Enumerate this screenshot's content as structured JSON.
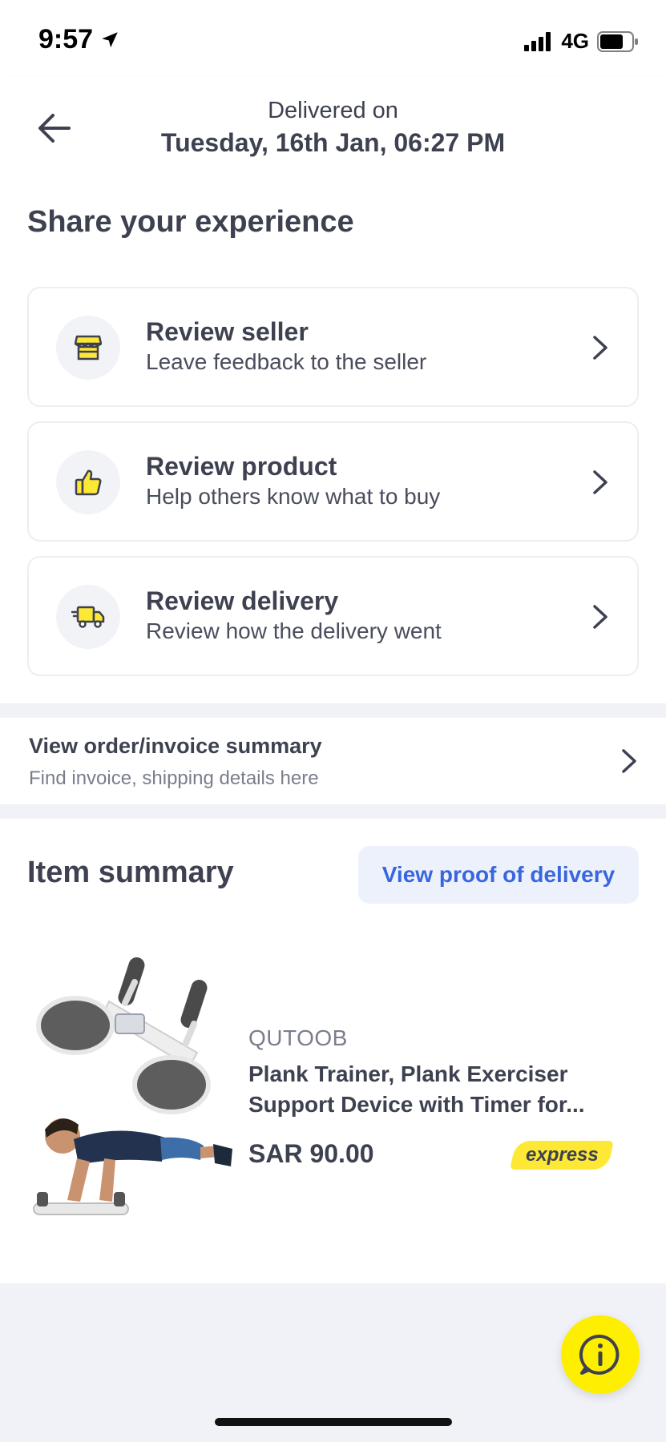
{
  "status_bar": {
    "time": "9:57",
    "network": "4G"
  },
  "header": {
    "subtitle": "Delivered on",
    "title": "Tuesday, 16th Jan, 06:27 PM"
  },
  "share": {
    "title": "Share your experience",
    "cards": [
      {
        "label": "Review seller",
        "description": "Leave feedback to the seller",
        "icon": "store-icon"
      },
      {
        "label": "Review product",
        "description": "Help others know what to buy",
        "icon": "thumbs-up-icon"
      },
      {
        "label": "Review delivery",
        "description": "Review how the delivery went",
        "icon": "delivery-truck-icon"
      }
    ]
  },
  "invoice": {
    "title": "View order/invoice summary",
    "description": "Find invoice, shipping details here"
  },
  "items": {
    "title": "Item summary",
    "proof_button": "View proof of delivery",
    "product": {
      "brand": "QUTOOB",
      "name": "Plank Trainer, Plank Exerciser Support Device with Timer for...",
      "price": "SAR 90.00",
      "badge": "express"
    }
  },
  "colors": {
    "accent_yellow": "#feee00",
    "link_blue": "#3866df",
    "text_dark": "#3d4150",
    "background": "#f1f2f7"
  }
}
